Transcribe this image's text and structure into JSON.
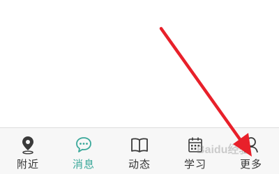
{
  "tab_bar": {
    "tabs": [
      {
        "label": "附近",
        "icon": "location-pin-icon",
        "active": false
      },
      {
        "label": "消息",
        "icon": "chat-bubble-icon",
        "active": true
      },
      {
        "label": "动态",
        "icon": "open-book-icon",
        "active": false
      },
      {
        "label": "学习",
        "icon": "calendar-icon",
        "active": false
      },
      {
        "label": "更多",
        "icon": "person-icon",
        "active": false
      }
    ]
  },
  "colors": {
    "active": "#3aa89a",
    "inactive": "#333333",
    "tab_bar_bg": "#f7f7f7",
    "arrow": "#e8202a"
  },
  "watermark": {
    "text": "Baidu经验"
  }
}
